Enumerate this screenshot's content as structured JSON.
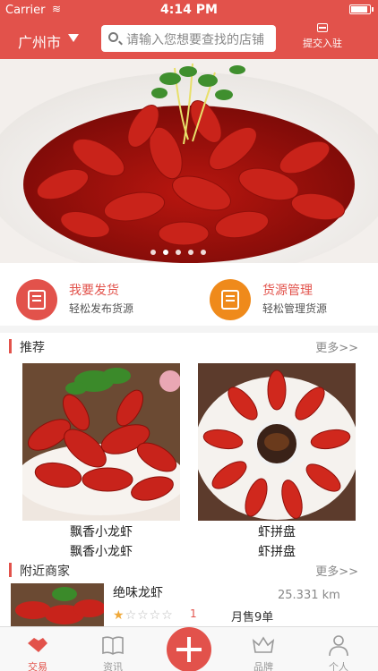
{
  "status": {
    "carrier": "Carrier",
    "time": "4:14 PM"
  },
  "header": {
    "city": "广州市",
    "search_placeholder": "请输入您想要查找的店铺",
    "submit_label": "提交入驻"
  },
  "banner": {
    "slide_count": 5,
    "active_slide": 1
  },
  "quick_actions": [
    {
      "title": "我要发货",
      "subtitle": "轻松发布货源",
      "color": "#e2524b",
      "icon": "edit-document-icon"
    },
    {
      "title": "货源管理",
      "subtitle": "轻松管理货源",
      "color": "#ef8a1b",
      "icon": "manage-document-icon"
    }
  ],
  "recommended": {
    "title": "推荐",
    "more": "更多>>",
    "items": [
      {
        "name": "飘香小龙虾",
        "subtitle": "飘香小龙虾"
      },
      {
        "name": "虾拼盘",
        "subtitle": "虾拼盘"
      }
    ]
  },
  "nearby": {
    "title": "附近商家",
    "more": "更多>>",
    "items": [
      {
        "name": "绝味龙虾",
        "distance": "25.331 km",
        "rating": 1,
        "score": "1",
        "sales": "月售9单"
      }
    ]
  },
  "tabbar": {
    "items": [
      {
        "label": "交易",
        "icon": "handshake-icon",
        "active": true
      },
      {
        "label": "资讯",
        "icon": "book-icon",
        "active": false
      },
      {
        "label": "",
        "icon": "plus-icon",
        "active": false
      },
      {
        "label": "品牌",
        "icon": "crown-icon",
        "active": false
      },
      {
        "label": "个人",
        "icon": "user-icon",
        "active": false
      }
    ]
  },
  "colors": {
    "primary": "#e2524b",
    "secondary": "#ef8a1b",
    "star": "#f0a93b"
  }
}
